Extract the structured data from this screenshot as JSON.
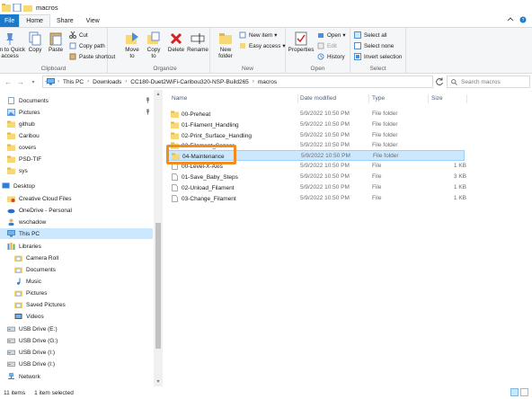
{
  "window": {
    "title": "macros"
  },
  "tabs": {
    "file": "File",
    "home": "Home",
    "share": "Share",
    "view": "View"
  },
  "ribbon": {
    "clipboard": {
      "label": "Clipboard",
      "pin_to_quick": "Pin to Quick\naccess",
      "copy": "Copy",
      "paste": "Paste",
      "cut": "Cut",
      "copy_path": "Copy path",
      "paste_shortcut": "Paste shortcut"
    },
    "organize": {
      "label": "Organize",
      "move_to": "Move\nto",
      "copy_to": "Copy\nto",
      "delete": "Delete",
      "rename": "Rename"
    },
    "new": {
      "label": "New",
      "new_folder": "New\nfolder",
      "new_item": "New item",
      "easy_access": "Easy access"
    },
    "open": {
      "label": "Open",
      "properties": "Properties",
      "open": "Open",
      "edit": "Edit",
      "history": "History"
    },
    "select": {
      "label": "Select",
      "select_all": "Select all",
      "select_none": "Select none",
      "invert": "Invert selection"
    }
  },
  "address": {
    "crumbs": [
      "This PC",
      "Downloads",
      "CC180-Duet2WiFi-Caribou320-NSP-Build265",
      "macros"
    ],
    "search_placeholder": "Search macros"
  },
  "nav": {
    "items": [
      {
        "label": "Documents",
        "icon": "documents-icon",
        "pinned": true
      },
      {
        "label": "Pictures",
        "icon": "pictures-icon",
        "pinned": true
      },
      {
        "label": "github",
        "icon": "folder-icon"
      },
      {
        "label": "Caribou",
        "icon": "folder-icon"
      },
      {
        "label": "covers",
        "icon": "folder-icon"
      },
      {
        "label": "PSD-TIF",
        "icon": "folder-icon"
      },
      {
        "label": "sys",
        "icon": "folder-icon"
      },
      {
        "label": "Desktop",
        "icon": "desktop-icon"
      },
      {
        "label": "Creative Cloud Files",
        "icon": "creative-cloud-icon"
      },
      {
        "label": "OneDrive - Personal",
        "icon": "onedrive-icon"
      },
      {
        "label": "wschadow",
        "icon": "user-icon"
      },
      {
        "label": "This PC",
        "icon": "this-pc-icon"
      },
      {
        "label": "Libraries",
        "icon": "libraries-icon"
      },
      {
        "label": "Camera Roll",
        "icon": "library-folder-icon"
      },
      {
        "label": "Documents",
        "icon": "library-folder-icon"
      },
      {
        "label": "Music",
        "icon": "music-icon"
      },
      {
        "label": "Pictures",
        "icon": "library-folder-icon"
      },
      {
        "label": "Saved Pictures",
        "icon": "library-folder-icon"
      },
      {
        "label": "Videos",
        "icon": "videos-icon"
      },
      {
        "label": "USB Drive (E:)",
        "icon": "usb-drive-icon"
      },
      {
        "label": "USB Drive (G:)",
        "icon": "usb-drive-icon"
      },
      {
        "label": "USB Drive (I:)",
        "icon": "usb-drive-icon"
      },
      {
        "label": "USB Drive (I:)",
        "icon": "usb-drive-icon"
      },
      {
        "label": "Network",
        "icon": "network-icon"
      }
    ]
  },
  "files": {
    "columns": {
      "name": "Name",
      "date": "Date modified",
      "type": "Type",
      "size": "Size"
    },
    "rows": [
      {
        "name": "00-Preheat",
        "date": "5/9/2022 10:50 PM",
        "type": "File folder",
        "size": "",
        "kind": "folder"
      },
      {
        "name": "01-Filament_Handling",
        "date": "5/9/2022 10:50 PM",
        "type": "File folder",
        "size": "",
        "kind": "folder"
      },
      {
        "name": "02-Print_Surface_Handling",
        "date": "5/9/2022 10:50 PM",
        "type": "File folder",
        "size": "",
        "kind": "folder"
      },
      {
        "name": "03-Filament_Sensor",
        "date": "5/9/2022 10:50 PM",
        "type": "File folder",
        "size": "",
        "kind": "folder"
      },
      {
        "name": "04-Maintenance",
        "date": "5/9/2022 10:50 PM",
        "type": "File folder",
        "size": "",
        "kind": "folder",
        "selected": true
      },
      {
        "name": "00-Level-X-Axis",
        "date": "5/9/2022 10:50 PM",
        "type": "File",
        "size": "1 KB",
        "kind": "file"
      },
      {
        "name": "01-Save_Baby_Steps",
        "date": "5/9/2022 10:50 PM",
        "type": "File",
        "size": "3 KB",
        "kind": "file"
      },
      {
        "name": "02-Unload_Filament",
        "date": "5/9/2022 10:50 PM",
        "type": "File",
        "size": "1 KB",
        "kind": "file"
      },
      {
        "name": "03-Change_Filament",
        "date": "5/9/2022 10:50 PM",
        "type": "File",
        "size": "1 KB",
        "kind": "file"
      }
    ]
  },
  "status": {
    "item_count": "11 items",
    "selected": "1 item selected"
  },
  "colors": {
    "accent": "#1979ca",
    "selection": "#cce8ff",
    "highlight": "#f28c1e",
    "folder": "#f8d775"
  }
}
